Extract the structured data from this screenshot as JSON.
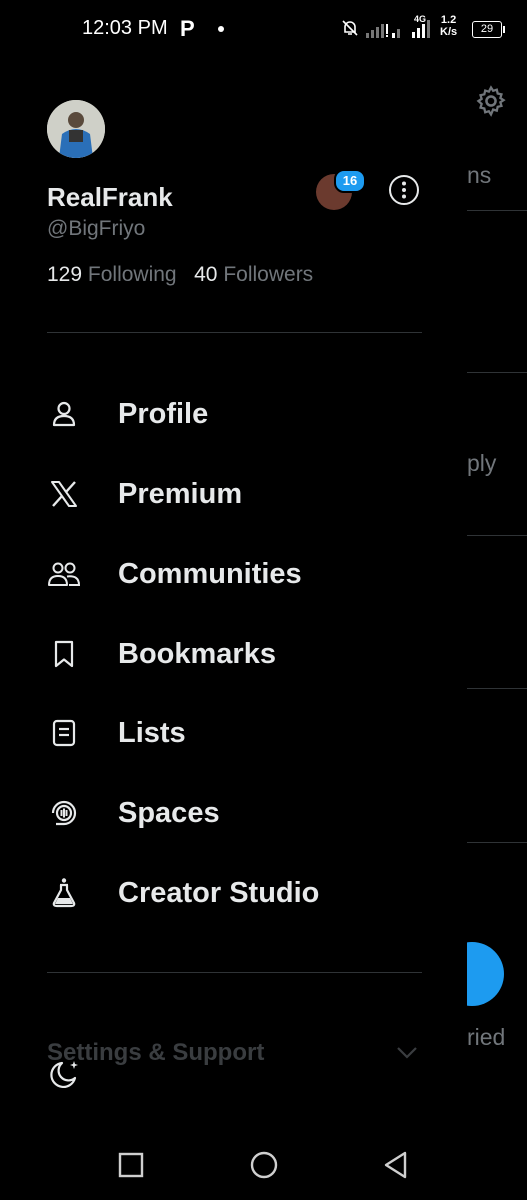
{
  "status_bar": {
    "time": "12:03 PM",
    "app_letter": "P",
    "network_type": "4G",
    "speed_value": "1.2",
    "speed_unit": "K/s",
    "battery": "29"
  },
  "background": {
    "partial_texts": [
      "ns",
      "ply",
      "ried"
    ]
  },
  "profile": {
    "display_name": "RealFrank",
    "handle": "@BigFriyo",
    "following_count": "129",
    "following_label": "Following",
    "followers_count": "40",
    "followers_label": "Followers",
    "notification_badge": "16"
  },
  "nav": {
    "items": [
      {
        "label": "Profile",
        "icon": "person-icon"
      },
      {
        "label": "Premium",
        "icon": "x-logo-icon"
      },
      {
        "label": "Communities",
        "icon": "communities-icon"
      },
      {
        "label": "Bookmarks",
        "icon": "bookmark-icon"
      },
      {
        "label": "Lists",
        "icon": "list-icon"
      },
      {
        "label": "Spaces",
        "icon": "spaces-icon"
      },
      {
        "label": "Creator Studio",
        "icon": "flask-icon"
      }
    ]
  },
  "settings": {
    "label": "Settings & Support"
  },
  "colors": {
    "background": "#000000",
    "text_primary": "#e7e9ea",
    "text_secondary": "#71767b",
    "accent": "#1d9bf0",
    "divider": "#2f3336"
  }
}
